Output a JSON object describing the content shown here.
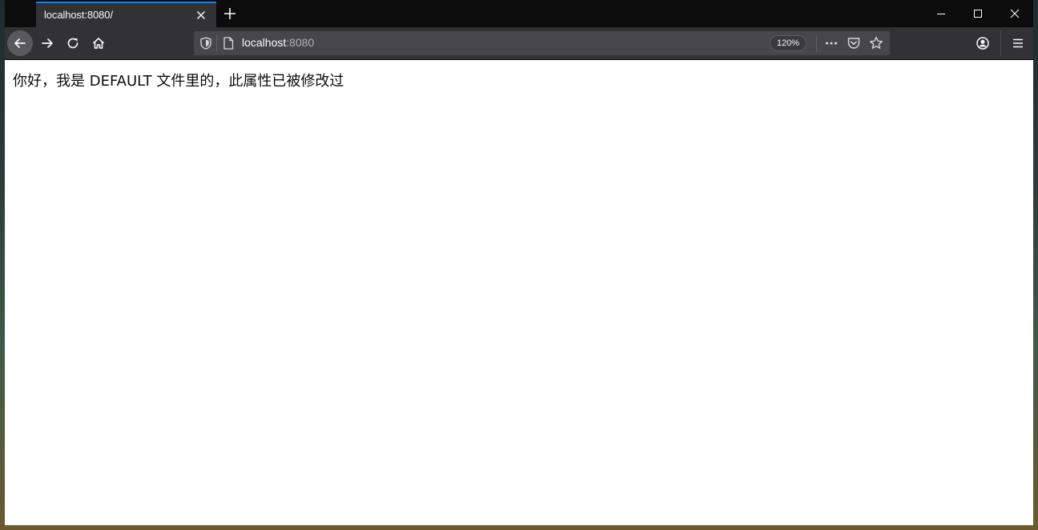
{
  "browser": {
    "tab": {
      "title": "localhost:8080/"
    },
    "url": {
      "host": "localhost",
      "port": ":8080"
    },
    "zoom": "120%",
    "icons": {
      "tab_close": "close-icon",
      "new_tab": "plus-icon",
      "back": "arrow-left-icon",
      "forward": "arrow-right-icon",
      "reload": "reload-icon",
      "home": "home-icon",
      "tracking": "shield-icon",
      "page_info": "page-icon",
      "more": "ellipsis-icon",
      "pocket": "pocket-icon",
      "bookmark": "star-icon",
      "account": "account-icon",
      "menu": "hamburger-icon"
    },
    "colors": {
      "accent": "#0a84ff",
      "toolbar": "#323234",
      "urlbar": "#474749"
    }
  },
  "page": {
    "message": "你好，我是 DEFAULT 文件里的，此属性已被修改过"
  }
}
